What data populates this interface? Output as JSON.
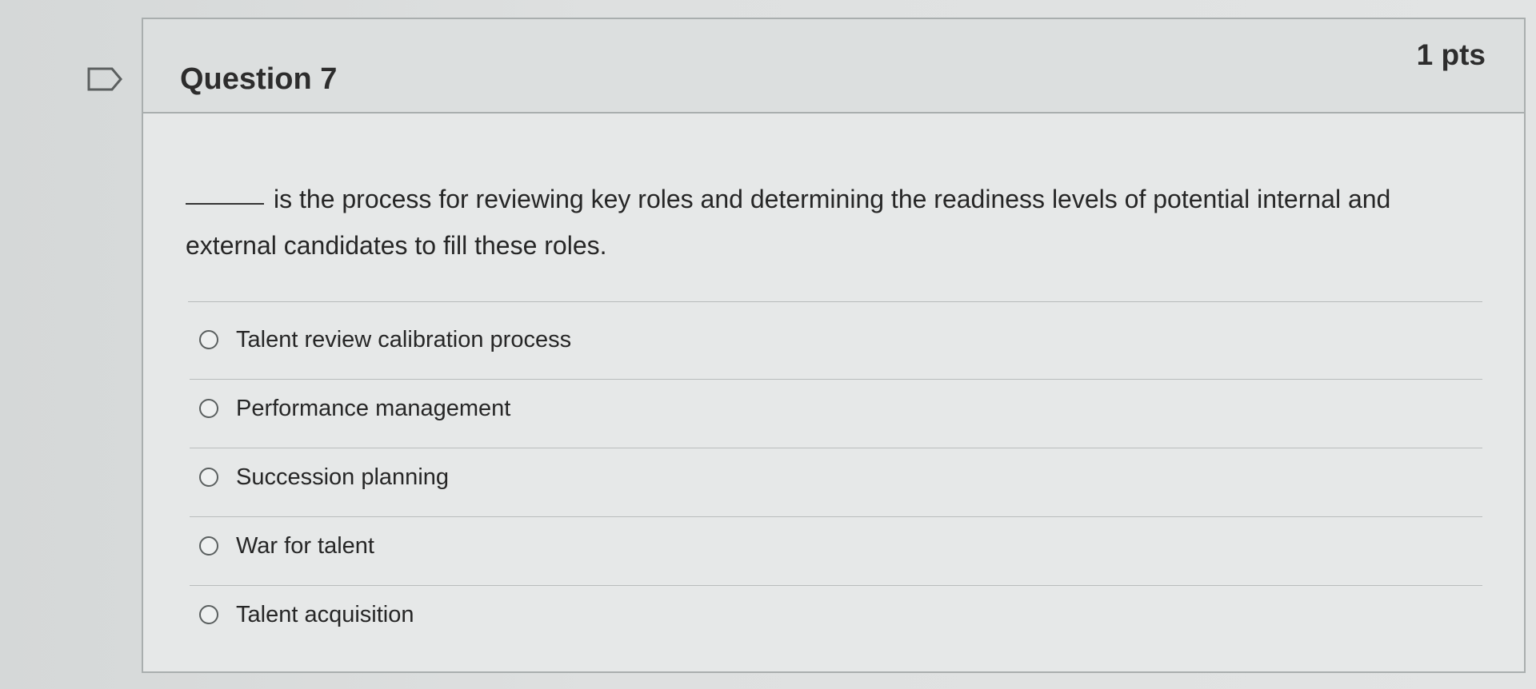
{
  "question": {
    "title": "Question 7",
    "points": "1 pts",
    "blank": "_____",
    "text": "is the process for reviewing key roles and determining the readiness levels of potential internal and external candidates to fill these roles.",
    "options": [
      "Talent review calibration process",
      "Performance management",
      "Succession planning",
      "War for talent",
      "Talent acquisition"
    ]
  }
}
